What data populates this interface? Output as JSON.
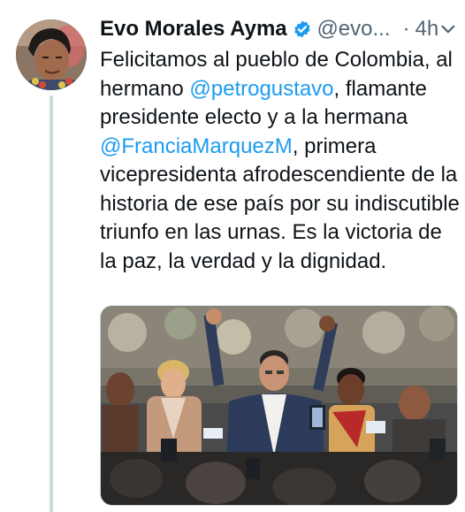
{
  "tweet": {
    "author_name": "Evo Morales Ayma",
    "handle": "@evo...",
    "separator": "·",
    "time": "4h",
    "text_1": "Felicitamos al pueblo de Colombia, al hermano ",
    "mention_1": "@petrogustavo",
    "text_2": ", flamante presidente electo y a la hermana ",
    "mention_2": "@FranciaMarquezM",
    "text_3": ", primera vicepresidenta afrodescendiente de la historia de ese país por su indiscutible triunfo en las urnas. Es la victoria de la paz, la verdad y la dignidad."
  },
  "icons": {
    "verified": "verified-badge-icon",
    "more": "chevron-down-icon"
  },
  "colors": {
    "accent": "#1d9bf0",
    "text": "#0f1419",
    "muted": "#536471",
    "thread_line": "#cfd9de"
  }
}
